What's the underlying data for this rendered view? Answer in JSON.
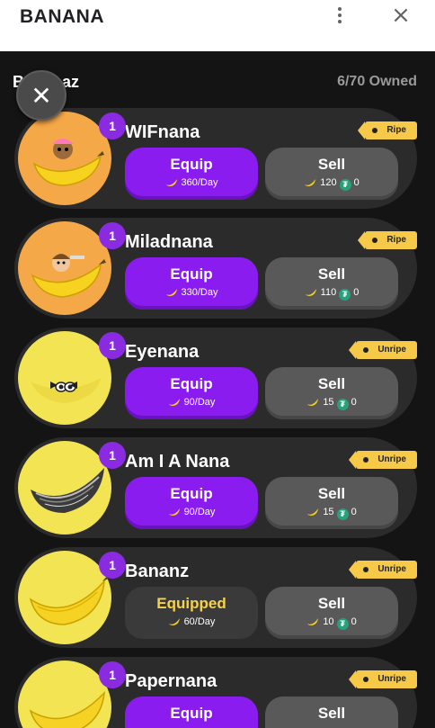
{
  "app": {
    "title": "BANANA"
  },
  "header": {
    "section_title": "Bananaz",
    "owned": "6/70 Owned"
  },
  "icons": {
    "banana": "banana-icon",
    "tether": "tether-icon",
    "close": "close-icon",
    "more": "more-vert-icon"
  },
  "colors": {
    "purple": "#8b1cf0",
    "yellow": "#f7c948",
    "ripe_bg": "#f5a847",
    "unripe_bg": "#f2e453"
  },
  "items": [
    {
      "count": "1",
      "name": "WIFnana",
      "tag": "Ripe",
      "action": "Equip",
      "rate": "360/Day",
      "sell": "Sell",
      "price_banana": "120",
      "price_tether": "0"
    },
    {
      "count": "1",
      "name": "Miladnana",
      "tag": "Ripe",
      "action": "Equip",
      "rate": "330/Day",
      "sell": "Sell",
      "price_banana": "110",
      "price_tether": "0"
    },
    {
      "count": "1",
      "name": "Eyenana",
      "tag": "Unripe",
      "action": "Equip",
      "rate": "90/Day",
      "sell": "Sell",
      "price_banana": "15",
      "price_tether": "0"
    },
    {
      "count": "1",
      "name": "Am I A Nana",
      "tag": "Unripe",
      "action": "Equip",
      "rate": "90/Day",
      "sell": "Sell",
      "price_banana": "15",
      "price_tether": "0"
    },
    {
      "count": "1",
      "name": "Bananz",
      "tag": "Unripe",
      "action": "Equipped",
      "rate": "60/Day",
      "sell": "Sell",
      "price_banana": "10",
      "price_tether": "0"
    },
    {
      "count": "1",
      "name": "Papernana",
      "tag": "Unripe",
      "action": "Equip",
      "rate": "",
      "sell": "Sell",
      "price_banana": "",
      "price_tether": ""
    }
  ]
}
